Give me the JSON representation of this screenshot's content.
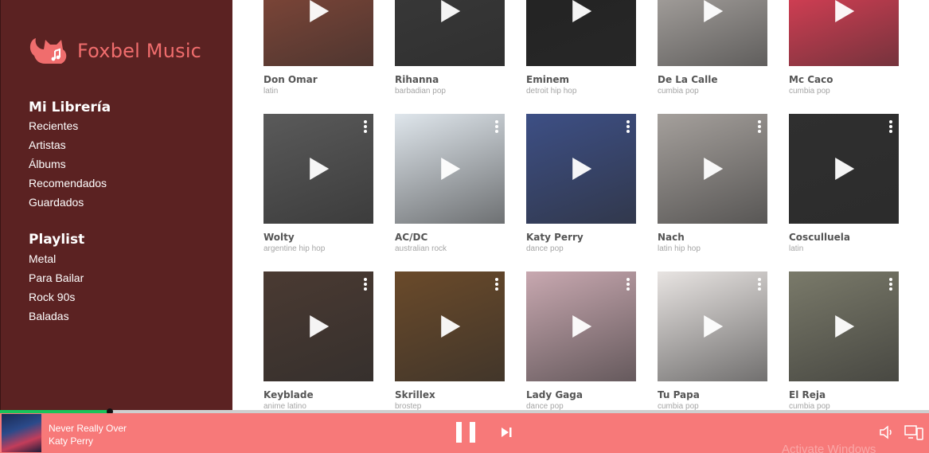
{
  "app": {
    "brand": "Foxbel Music"
  },
  "sidebar": {
    "library_title": "Mi Librería",
    "library_items": [
      "Recientes",
      "Artistas",
      "Álbums",
      "Recomendados",
      "Guardados"
    ],
    "playlist_title": "Playlist",
    "playlist_items": [
      "Metal",
      "Para Bailar",
      "Rock 90s",
      "Baladas"
    ]
  },
  "artists": [
    {
      "name": "Don Omar",
      "genre": "latin",
      "image": "photo-portrait",
      "color": "#8b4a3a"
    },
    {
      "name": "Rihanna",
      "genre": "barbadian pop",
      "image": "photo-portrait",
      "color": "#3a3a3a"
    },
    {
      "name": "Eminem",
      "genre": "detroit hip hop",
      "image": "photo-portrait",
      "color": "#222222"
    },
    {
      "name": "De La Calle",
      "genre": "cumbia pop",
      "image": "photo-portrait",
      "color": "#b9b4b0"
    },
    {
      "name": "Mc Caco",
      "genre": "cumbia pop",
      "image": "cover-art",
      "color": "#f2425b"
    },
    {
      "name": "Wolty",
      "genre": "argentine hip hop",
      "image": "photo-portrait",
      "color": "#5a5a5a"
    },
    {
      "name": "AC/DC",
      "genre": "australian rock",
      "image": "photo-portrait",
      "color": "#dfe6ec"
    },
    {
      "name": "Katy Perry",
      "genre": "dance pop",
      "image": "photo-portrait",
      "color": "#3d4f85"
    },
    {
      "name": "Nach",
      "genre": "latin hip hop",
      "image": "photo-portrait",
      "color": "#a5a09c"
    },
    {
      "name": "Cosculluela",
      "genre": "latin",
      "image": "photo-portrait",
      "color": "#2f2f2f"
    },
    {
      "name": "Keyblade",
      "genre": "anime latino",
      "image": "photo-portrait",
      "color": "#4a3a32"
    },
    {
      "name": "Skrillex",
      "genre": "brostep",
      "image": "photo-portrait",
      "color": "#6a4a2a"
    },
    {
      "name": "Lady Gaga",
      "genre": "dance pop",
      "image": "photo-portrait",
      "color": "#c8a8b0"
    },
    {
      "name": "Tu Papa",
      "genre": "cumbia pop",
      "image": "photo-portrait",
      "color": "#e8e4e2"
    },
    {
      "name": "El Reja",
      "genre": "cumbia pop",
      "image": "photo-portrait",
      "color": "#7a7a6a"
    }
  ],
  "player": {
    "track": "Never Really Over",
    "artist": "Katy Perry",
    "progress": 0.118,
    "state": "playing",
    "colors": {
      "bar": "#f77979",
      "progress": "#19c45a",
      "sidebar": "#5b2222",
      "brand": "#f06d6d"
    }
  },
  "watermark": "Activate Windows"
}
